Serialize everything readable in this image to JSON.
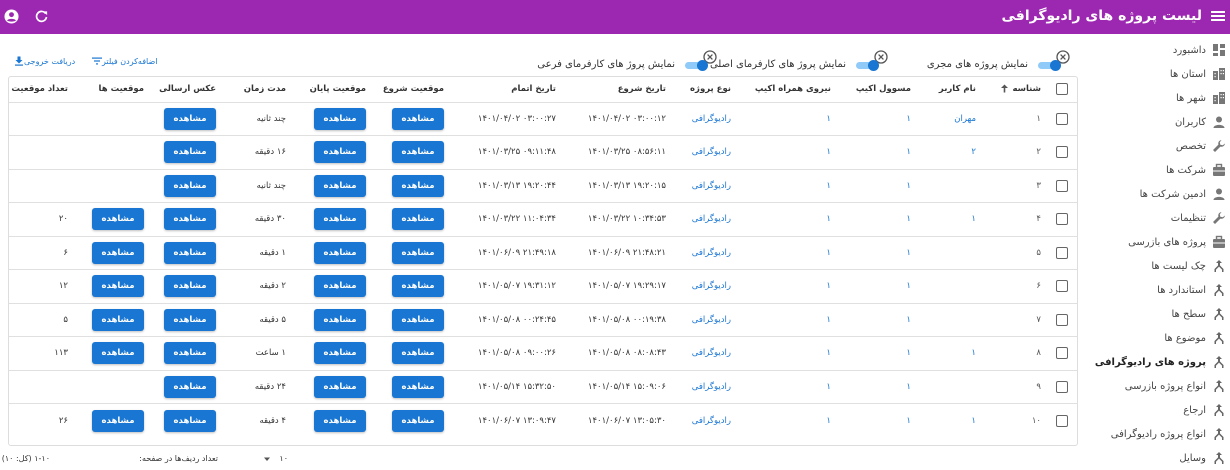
{
  "header": {
    "title": "لیست پروژه های رادیوگرافی",
    "menu_icon": "menu-icon",
    "user_icon": "account-circle-icon",
    "refresh_icon": "refresh-icon",
    "color": "#9c27b0"
  },
  "sidebar": {
    "items": [
      {
        "label": "داشبورد",
        "icon": "dashboard-icon"
      },
      {
        "label": "استان ها",
        "icon": "city-icon"
      },
      {
        "label": "شهر ها",
        "icon": "city-icon"
      },
      {
        "label": "کاربران",
        "icon": "person-icon"
      },
      {
        "label": "تخصص",
        "icon": "wrench-icon"
      },
      {
        "label": "شرکت ها",
        "icon": "briefcase-icon"
      },
      {
        "label": "ادمین شرکت ها",
        "icon": "person-icon"
      },
      {
        "label": "تنظیمات",
        "icon": "wrench-icon"
      },
      {
        "label": "پروژه های بازرسی",
        "icon": "briefcase-icon"
      },
      {
        "label": "چک لیست ها",
        "icon": "merge-icon"
      },
      {
        "label": "استاندارد ها",
        "icon": "merge-icon"
      },
      {
        "label": "سطح ها",
        "icon": "merge-icon"
      },
      {
        "label": "موضوع ها",
        "icon": "merge-icon"
      },
      {
        "label": "پروژه های رادیوگرافی",
        "icon": "merge-icon"
      },
      {
        "label": "انواع پروژه بازرسی",
        "icon": "merge-icon"
      },
      {
        "label": "ارجاع",
        "icon": "merge-icon"
      },
      {
        "label": "انواع پروژه رادیوگرافی",
        "icon": "merge-icon"
      },
      {
        "label": "وسایل",
        "icon": "merge-icon"
      }
    ],
    "active_index": 13
  },
  "toggles": [
    {
      "label": "نمایش پروژه های مجری",
      "on": true
    },
    {
      "label": "نمایش پروژ های کارفرمای اصلی",
      "on": true
    },
    {
      "label": "نمایش پروژ های کارفرمای فرعی",
      "on": true
    }
  ],
  "toolbar": {
    "filter_label": "اضافه‌کردن فیلتر",
    "export_label": "دریافت خروجی",
    "accent": "#1976d2"
  },
  "table": {
    "columns": [
      "شناسه",
      "نام کاربر",
      "مسوول اکیپ",
      "نیروی همراه اکیپ",
      "نوع پروژه",
      "تاریخ شروع",
      "تاریخ اتمام",
      "موقعیت شروع",
      "موقعیت پایان",
      "مدت زمان",
      "عکس ارسالی",
      "موقعیت ها",
      "تعداد موقعیت ها"
    ],
    "view_label": "مشاهده",
    "rows": [
      {
        "id": "۱",
        "user": "مهران",
        "head": "۱",
        "crew": "۱",
        "type": "رادیوگرافی",
        "start": "۰۳:۰۰:۱۲ ۱۴۰۱/۰۴/۰۲",
        "end": "۰۳:۰۰:۲۷ ۱۴۰۱/۰۴/۰۲",
        "duration": "چند ثانیه",
        "positions": false,
        "count": ""
      },
      {
        "id": "۲",
        "user": "۲",
        "head": "۱",
        "crew": "۱",
        "type": "رادیوگرافی",
        "start": "۰۸:۵۶:۱۱ ۱۴۰۱/۰۳/۲۵",
        "end": "۰۹:۱۱:۴۸ ۱۴۰۱/۰۳/۲۵",
        "duration": "۱۶ دقیقه",
        "positions": false,
        "count": ""
      },
      {
        "id": "۳",
        "user": "",
        "head": "۱",
        "crew": "۱",
        "type": "رادیوگرافی",
        "start": "۱۹:۲۰:۱۵ ۱۴۰۱/۰۳/۱۳",
        "end": "۱۹:۲۰:۴۴ ۱۴۰۱/۰۳/۱۳",
        "duration": "چند ثانیه",
        "positions": false,
        "count": ""
      },
      {
        "id": "۴",
        "user": "۱",
        "head": "۱",
        "crew": "۱",
        "type": "رادیوگرافی",
        "start": "۱۰:۳۴:۵۳ ۱۴۰۱/۰۳/۲۲",
        "end": "۱۱:۰۴:۳۴ ۱۴۰۱/۰۳/۲۲",
        "duration": "۳۰ دقیقه",
        "positions": true,
        "count": "۲۰"
      },
      {
        "id": "۵",
        "user": "",
        "head": "۱",
        "crew": "۱",
        "type": "رادیوگرافی",
        "start": "۲۱:۴۸:۲۱ ۱۴۰۱/۰۶/۰۹",
        "end": "۲۱:۴۹:۱۸ ۱۴۰۱/۰۶/۰۹",
        "duration": "۱ دقیقه",
        "positions": true,
        "count": "۶"
      },
      {
        "id": "۶",
        "user": "",
        "head": "۱",
        "crew": "۱",
        "type": "رادیوگرافی",
        "start": "۱۹:۲۹:۱۷ ۱۴۰۱/۰۵/۰۷",
        "end": "۱۹:۳۱:۱۲ ۱۴۰۱/۰۵/۰۷",
        "duration": "۲ دقیقه",
        "positions": true,
        "count": "۱۲"
      },
      {
        "id": "۷",
        "user": "",
        "head": "۱",
        "crew": "۱",
        "type": "رادیوگرافی",
        "start": "۰۰:۱۹:۳۸ ۱۴۰۱/۰۵/۰۸",
        "end": "۰۰:۲۴:۴۵ ۱۴۰۱/۰۵/۰۸",
        "duration": "۵ دقیقه",
        "positions": true,
        "count": "۵"
      },
      {
        "id": "۸",
        "user": "۱",
        "head": "۱",
        "crew": "۱",
        "type": "رادیوگرافی",
        "start": "۰۸:۰۸:۴۳ ۱۴۰۱/۰۵/۰۸",
        "end": "۰۹:۰۰:۲۶ ۱۴۰۱/۰۵/۰۸",
        "duration": "۱ ساعت",
        "positions": true,
        "count": "۱۱۳"
      },
      {
        "id": "۹",
        "user": "",
        "head": "۱",
        "crew": "۱",
        "type": "رادیوگرافی",
        "start": "۱۵:۰۹:۰۶ ۱۴۰۱/۰۵/۱۴",
        "end": "۱۵:۳۲:۵۰ ۱۴۰۱/۰۵/۱۴",
        "duration": "۲۴ دقیقه",
        "positions": false,
        "count": ""
      },
      {
        "id": "۱۰",
        "user": "۱",
        "head": "۱",
        "crew": "۱",
        "type": "رادیوگرافی",
        "start": "۱۳:۰۵:۳۰ ۱۴۰۱/۰۶/۰۷",
        "end": "۱۳:۰۹:۴۷ ۱۴۰۱/۰۶/۰۷",
        "duration": "۴ دقیقه",
        "positions": true,
        "count": "۲۶"
      }
    ]
  },
  "pagination": {
    "rows_label": "تعداد ردیف‌ها در صفحه:",
    "rows_value": "۱۰",
    "range": "۱-۱۰ (کل: ۱۰)"
  }
}
